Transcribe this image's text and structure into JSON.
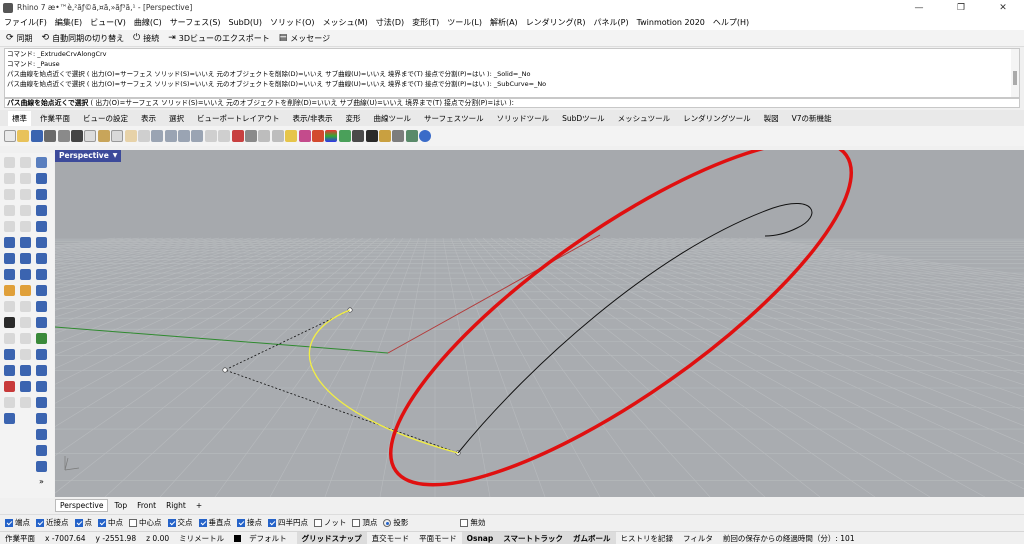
{
  "window": {
    "title": "Rhino 7 æ•™è‚²ãƒ©ã‚¤ã‚»ãƒ³ã‚¹ - [Perspective]",
    "controls": {
      "minimize": "—",
      "maximize": "❐",
      "close": "✕"
    }
  },
  "menu": [
    "ファイル(F)",
    "編集(E)",
    "ビュー(V)",
    "曲線(C)",
    "サーフェス(S)",
    "SubD(U)",
    "ソリッド(O)",
    "メッシュ(M)",
    "寸法(D)",
    "変形(T)",
    "ツール(L)",
    "解析(A)",
    "レンダリング(R)",
    "パネル(P)",
    "Twinmotion 2020",
    "ヘルプ(H)"
  ],
  "toolbar": {
    "sync": "同期",
    "auto_sync": "自動同期の切り替え",
    "connect": "接続",
    "export_3d": "3Dビューのエクスポート",
    "message": "メッセージ"
  },
  "command_history": [
    "コマンド: _ExtrudeCrvAlongCrv",
    "コマンド: _Pause",
    "パス曲線を始点近くで選択 ( 出力(O)=サーフェス ソリッド(S)=いいえ 元のオブジェクトを削除(D)=いいえ サブ曲線(U)=いいえ 境界まで(T) 接点で分割(P)=はい ): _Solid=_No",
    "パス曲線を始点近くで選択 ( 出力(O)=サーフェス ソリッド(S)=いいえ 元のオブジェクトを削除(D)=いいえ サブ曲線(U)=いいえ 境界まで(T) 接点で分割(P)=はい ): _SubCurve=_No"
  ],
  "command_prompt": {
    "lead": "パス曲線を始点近くで選択",
    "rest": " ( 出力(O)=サーフェス ソリッド(S)=いいえ 元のオブジェクトを削除(D)=いいえ サブ曲線(U)=いいえ 境界まで(T) 接点で分割(P)=はい ):"
  },
  "tabs": [
    "標準",
    "作業平面",
    "ビューの設定",
    "表示",
    "選択",
    "ビューポートレイアウト",
    "表示/非表示",
    "変形",
    "曲線ツール",
    "サーフェスツール",
    "ソリッドツール",
    "SubDツール",
    "メッシュツール",
    "レンダリングツール",
    "製図",
    "V7の新機能"
  ],
  "viewport": {
    "name": "Perspective",
    "dropdown": "▼"
  },
  "view_tabs": [
    "Perspective",
    "Top",
    "Front",
    "Right",
    "+"
  ],
  "osnaps": [
    {
      "label": "端点",
      "checked": true
    },
    {
      "label": "近接点",
      "checked": true
    },
    {
      "label": "点",
      "checked": true
    },
    {
      "label": "中点",
      "checked": true
    },
    {
      "label": "中心点",
      "checked": false
    },
    {
      "label": "交点",
      "checked": true
    },
    {
      "label": "垂直点",
      "checked": true
    },
    {
      "label": "接点",
      "checked": true
    },
    {
      "label": "四半円点",
      "checked": true
    },
    {
      "label": "ノット",
      "checked": false
    },
    {
      "label": "頂点",
      "checked": false
    },
    {
      "label": "投影",
      "radio": true
    },
    {
      "label": "無効",
      "checked": false
    }
  ],
  "status": {
    "plane": "作業平面",
    "x": "x -7007.64",
    "y": "y -2551.98",
    "z": "z 0.00",
    "unit": "ミリメートル",
    "layer": "デフォルト",
    "grid_snap": "グリッドスナップ",
    "ortho": "直交モード",
    "planar": "平面モード",
    "osnap": "Osnap",
    "smart_track": "スマートトラック",
    "gumball": "ガムボール",
    "history": "ヒストリを記録",
    "filter": "フィルタ",
    "save_time": "前回の保存からの経過時間（分）: 101"
  },
  "colors": {
    "viewport_bg": "#a7aaae",
    "grid": "#b9bcbf",
    "highlight_ellipse": "#e01010",
    "yellow_curve": "#f2ee44",
    "x_axis": "#b33a3a",
    "y_axis": "#2f8a2f"
  }
}
